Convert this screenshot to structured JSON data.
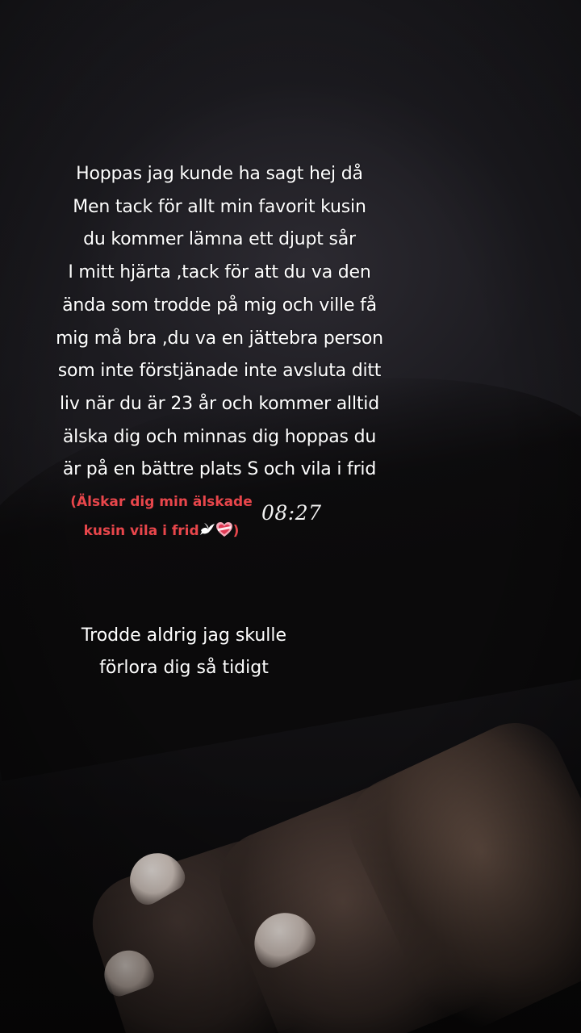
{
  "main_message": {
    "lines": [
      "Hoppas jag kunde ha sagt hej då",
      "Men tack för allt min favorit kusin",
      "du kommer lämna ett djupt sår",
      "I mitt hjärta ,tack för att du va den",
      "ända som trodde på mig och ville få",
      "mig må bra ,du va en jättebra person",
      "som inte förstjänade inte avsluta ditt",
      "liv när du är 23 år och kommer alltid",
      "älska dig och minnas dig hoppas du",
      "är på en bättre plats S och vila i frid"
    ]
  },
  "red_message": {
    "line1": "(Älskar dig min älskade",
    "line2_text": "kusin vila i frid",
    "line2_close": ")",
    "icons": [
      "dove-icon",
      "heart-icon"
    ],
    "color": "#e8464b"
  },
  "timestamp": "08:27",
  "secondary_message": {
    "lines": [
      "Trodde aldrig jag skulle",
      "förlora dig så tidigt"
    ]
  },
  "colors": {
    "text": "#ffffff",
    "accent_red": "#e8464b",
    "background": "#1a191d"
  }
}
